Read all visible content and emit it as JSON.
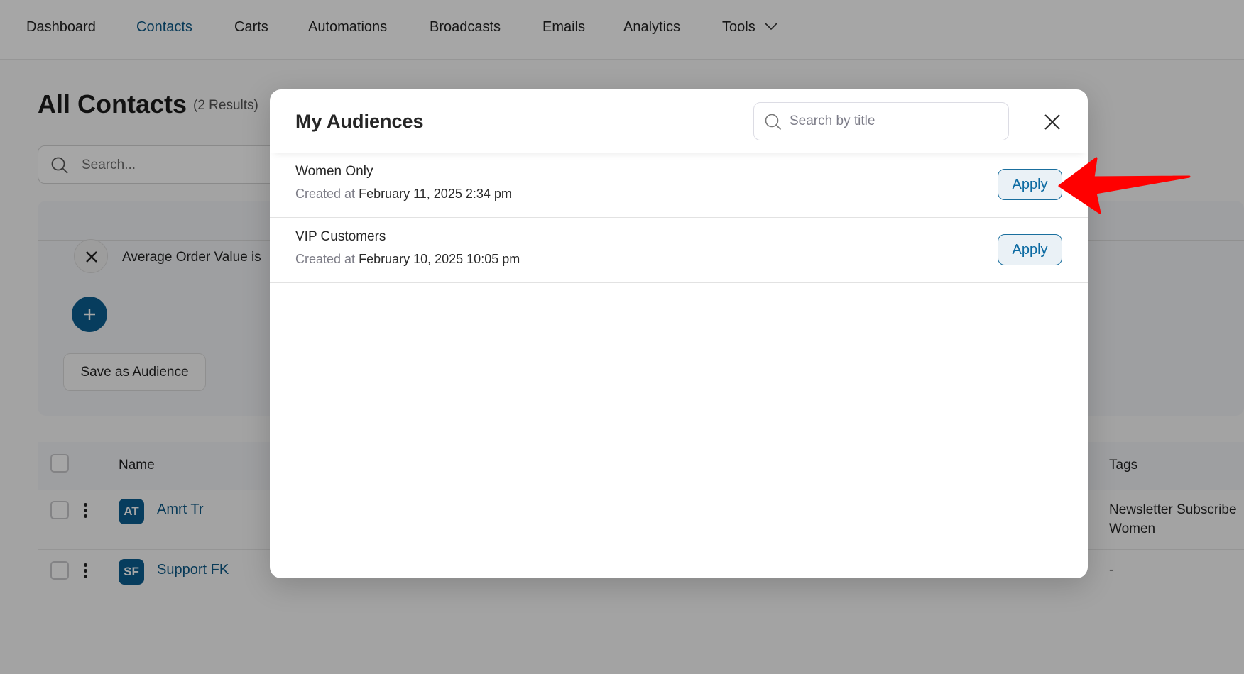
{
  "nav": {
    "items": [
      {
        "label": "Dashboard",
        "active": false
      },
      {
        "label": "Contacts",
        "active": true
      },
      {
        "label": "Carts",
        "active": false
      },
      {
        "label": "Automations",
        "active": false
      },
      {
        "label": "Broadcasts",
        "active": false
      },
      {
        "label": "Emails",
        "active": false
      },
      {
        "label": "Analytics",
        "active": false
      },
      {
        "label": "Tools",
        "active": false,
        "has_dropdown": true
      }
    ],
    "dropdown_icon": "chevron-down-icon"
  },
  "page": {
    "title": "All Contacts",
    "result_count": "(2 Results)",
    "search_placeholder": "Search...",
    "filter": {
      "rule_text": "Average Order Value is",
      "save_audience_label": "Save as Audience"
    },
    "table": {
      "columns": {
        "name": "Name",
        "tags": "Tags"
      },
      "rows": [
        {
          "initials": "AT",
          "name": "Amrt Tr",
          "tags": [
            "Newsletter Subscribe",
            "Women"
          ]
        },
        {
          "initials": "SF",
          "name": "Support FK",
          "tags": [
            "-"
          ]
        }
      ]
    }
  },
  "modal": {
    "title": "My Audiences",
    "search_placeholder": "Search by title",
    "search_value": "",
    "created_label": "Created at",
    "apply_label": "Apply",
    "audiences": [
      {
        "title": "Women Only",
        "created": "February 11, 2025 2:34 pm"
      },
      {
        "title": "VIP Customers",
        "created": "February 10, 2025 10:05 pm"
      }
    ]
  },
  "annotation": {
    "arrow_color": "#ff0000",
    "points_to": "apply-button-women-only"
  },
  "colors": {
    "brand": "#0b5e91",
    "link": "#0d5a88",
    "apply_text": "#0b6aa2",
    "apply_bg": "#eaf1f6"
  }
}
